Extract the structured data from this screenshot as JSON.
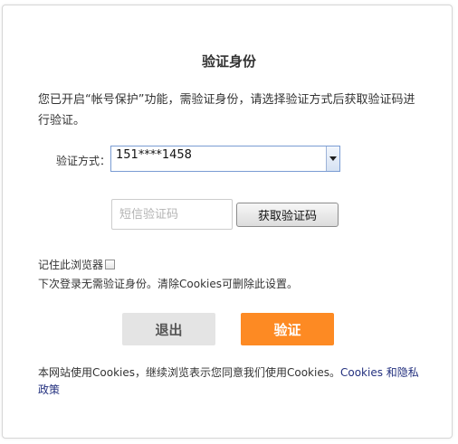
{
  "dialog": {
    "title": "验证身份",
    "intro": "您已开启“帐号保护”功能，需验证身份，请选择验证方式后获取验证码进行验证。"
  },
  "method": {
    "label": "验证方式：",
    "selected": "151****1458"
  },
  "code": {
    "placeholder": "短信验证码",
    "get_code_label": "获取验证码"
  },
  "remember": {
    "label": "记住此浏览器",
    "checked": false,
    "note": "下次登录无需验证身份。清除Cookies可删除此设置。"
  },
  "actions": {
    "exit_label": "退出",
    "verify_label": "验证"
  },
  "footer": {
    "text": "本网站使用Cookies，继续浏览表示您同意我们使用Cookies。",
    "link_label": "Cookies 和隐私政策"
  },
  "colors": {
    "verify_button": "#fd8a23",
    "exit_button": "#e4e4e4",
    "link": "#24317f"
  }
}
